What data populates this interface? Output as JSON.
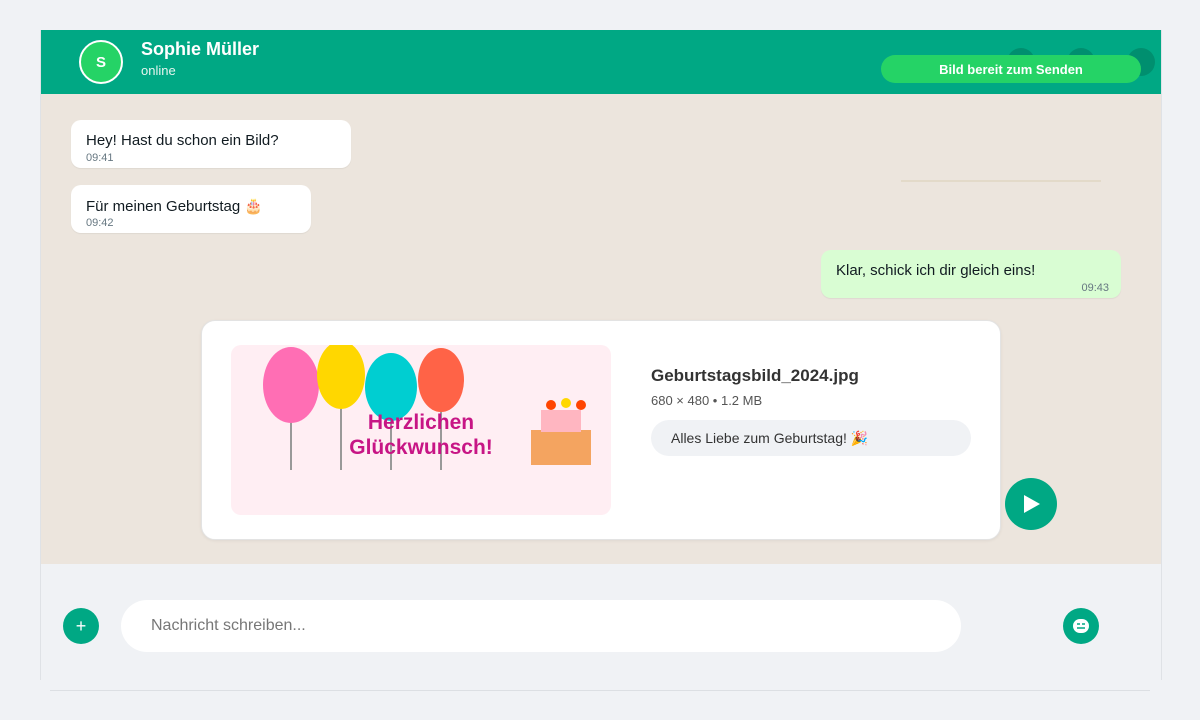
{
  "header": {
    "avatar_initial": "S",
    "contact_name": "Sophie Müller",
    "contact_status": "online",
    "ready_badge": "Bild bereit zum Senden",
    "icons": [
      "header-action-icon",
      "header-action-icon",
      "menu-icon"
    ]
  },
  "messages": [
    {
      "direction": "incoming",
      "text": "Hey! Hast du schon ein Bild?",
      "time": "09:41"
    },
    {
      "direction": "incoming",
      "text": "Für meinen Geburtstag 🎂",
      "time": "09:42"
    },
    {
      "direction": "outgoing",
      "text": "Klar, schick ich dir gleich eins!",
      "time": "09:43"
    }
  ],
  "image_preview": {
    "greeting_line1": "Herzlichen",
    "greeting_line2": "Glückwunsch!",
    "file_name": "Geburtstagsbild_2024.jpg",
    "file_meta": "680 × 480 • 1.2 MB",
    "caption": "Alles Liebe zum Geburtstag! 🎉",
    "balloon_colors": [
      "#ff6eb4",
      "#ffd700",
      "#00ced1",
      "#ff6347"
    ]
  },
  "composer": {
    "attach_icon": "plus-icon",
    "attach_label": "+",
    "input_placeholder": "Nachricht schreiben...",
    "emoji_icon": "emoji-icon",
    "send_icon": "send-icon"
  },
  "colors": {
    "brand": "#00a884",
    "accent": "#25d366",
    "chat_background": "#ece5dd",
    "outgoing_bubble": "#d9fdd3"
  }
}
